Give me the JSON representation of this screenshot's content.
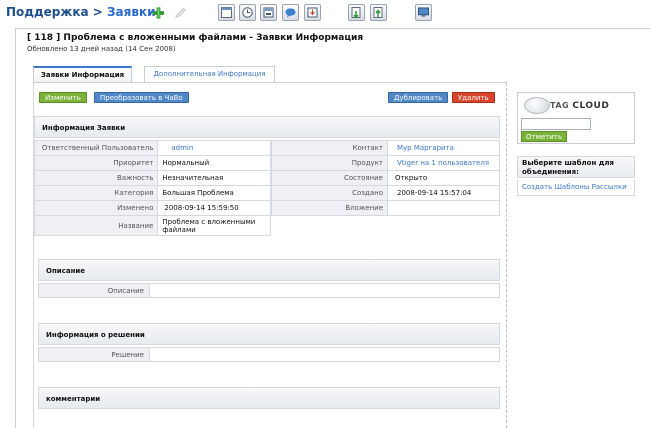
{
  "breadcrumb": {
    "parent": "Поддержка",
    "separator": ">",
    "current": "Заявки"
  },
  "toolbar": {
    "icons": [
      "add-icon",
      "edit-icon",
      "window-icon",
      "clock-icon",
      "calendar-icon",
      "chat-icon",
      "download-icon",
      "import-icon",
      "export-icon",
      "monitor-icon"
    ]
  },
  "ticket": {
    "title": "[ 118 ] Проблема с вложенными файлами - Заявки Информация",
    "updated": "Обновлено 13 дней назад (14 Сен 2008)"
  },
  "tabs": [
    {
      "label": "Заявки Информация",
      "active": true
    },
    {
      "label": "Дополнительная Информация",
      "active": false
    }
  ],
  "actions": {
    "edit": "Изменить",
    "convert": "Преобразовать в ЧаВо",
    "duplicate": "Дублировать",
    "delete": "Удалить"
  },
  "info": {
    "heading": "Информация Заявки",
    "left": [
      {
        "label": "Ответственный Пользователь",
        "value": "admin"
      },
      {
        "label": "Приоритет",
        "value": "Нормальный"
      },
      {
        "label": "Важность",
        "value": "Незначительная"
      },
      {
        "label": "Категория",
        "value": "Большая Проблема"
      },
      {
        "label": "Изменено",
        "value": "2008-09-14 15:59:50"
      },
      {
        "label": "Название",
        "value": "Проблема с вложенными файлами"
      }
    ],
    "right": [
      {
        "label": "Контакт",
        "value": "Мур Маргарита"
      },
      {
        "label": "Продукт",
        "value": "Vtiger на 1 пользователя"
      },
      {
        "label": "Состояние",
        "value": "Открыто"
      },
      {
        "label": "Создано",
        "value": "2008-09-14 15:57:04"
      },
      {
        "label": "Вложение",
        "value": ""
      }
    ]
  },
  "description": {
    "heading": "Описание",
    "label": "Описание",
    "value": ""
  },
  "solution": {
    "heading": "Информация о решении",
    "label": "Решение",
    "value": ""
  },
  "comments": {
    "heading": "комментарии"
  },
  "tagcloud": {
    "title_small": "TAG",
    "title_big": "CLOUD",
    "input_value": "",
    "button": "Отметить"
  },
  "templates": {
    "heading": "Выберите шаблон для объединения:",
    "link": "Создать Шаблоны Рассылки"
  },
  "colors": {
    "link": "#3b79c8",
    "green": "#7bb33a",
    "blue": "#4f87c7",
    "red": "#d9442b"
  }
}
